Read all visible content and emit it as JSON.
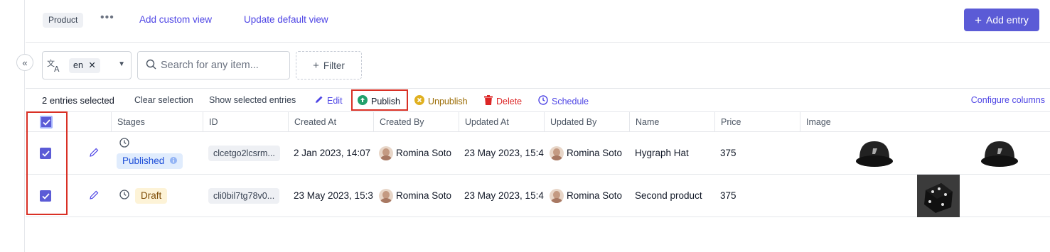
{
  "topbar": {
    "model": "Product",
    "add_custom_view": "Add custom view",
    "update_default_view": "Update default view",
    "add_entry": "Add entry"
  },
  "toolbar": {
    "locale": "en",
    "search_placeholder": "Search for any item...",
    "filter": "Filter"
  },
  "selection": {
    "count": "2 entries selected",
    "clear": "Clear selection",
    "show_selected": "Show selected entries",
    "edit": "Edit",
    "publish": "Publish",
    "unpublish": "Unpublish",
    "delete": "Delete",
    "schedule": "Schedule",
    "configure_columns": "Configure columns"
  },
  "columns": [
    "Stages",
    "ID",
    "Created At",
    "Created By",
    "Updated At",
    "Updated By",
    "Name",
    "Price",
    "Image"
  ],
  "rows": [
    {
      "stage": "Published",
      "id": "clcetgo2lcsrm...",
      "created_at": "2 Jan 2023, 14:07",
      "created_by": "Romina Soto",
      "updated_at": "23 May 2023, 15:4",
      "updated_by": "Romina Soto",
      "name": "Hygraph Hat",
      "price": "375",
      "image_icons": [
        "cap-image",
        "cap-image"
      ]
    },
    {
      "stage": "Draft",
      "id": "cli0bil7tg78v0...",
      "created_at": "23 May 2023, 15:3",
      "created_by": "Romina Soto",
      "updated_at": "23 May 2023, 15:4",
      "updated_by": "Romina Soto",
      "name": "Second product",
      "price": "375",
      "image_icons": [
        "dice-image"
      ]
    }
  ],
  "colors": {
    "accent": "#5b5bd6",
    "link": "#4f46e5",
    "publish": "#22a06b",
    "unpublish": "#d4a017",
    "delete": "#dc2626",
    "highlight": "#d93025"
  }
}
